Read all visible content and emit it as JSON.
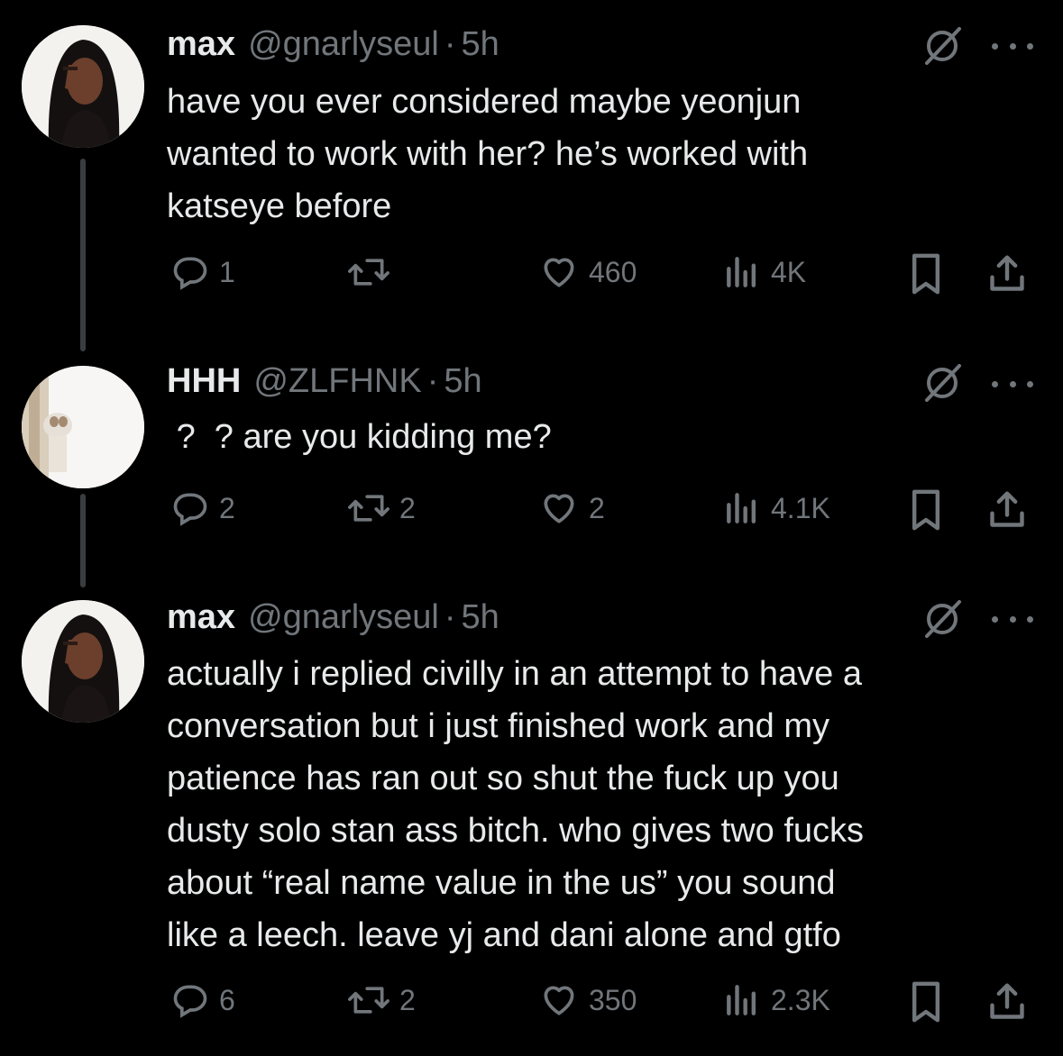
{
  "tweets": [
    {
      "name": "max",
      "handle": "@gnarlyseul",
      "dot": "·",
      "time": "5h",
      "text": "have you ever considered maybe yeonjun\nwanted to work with her? he’s worked with\nkatseye before",
      "replies": "1",
      "retweets": "",
      "likes": "460",
      "views": "4K"
    },
    {
      "name": "HHH",
      "handle": "@ZLFHNK",
      "dot": "·",
      "time": "5h",
      "text": " ?  ? are you kidding me?",
      "replies": "2",
      "retweets": "2",
      "likes": "2",
      "views": "4.1K"
    },
    {
      "name": "max",
      "handle": "@gnarlyseul",
      "dot": "·",
      "time": "5h",
      "text": "actually i replied civilly in an attempt to have a\nconversation but i just finished work and my\npatience has ran out so shut the fuck up you\ndusty solo stan ass bitch. who gives two fucks\nabout “real name value in the us” you sound\nlike a leech. leave yj and dani alone and gtfo",
      "replies": "6",
      "retweets": "2",
      "likes": "350",
      "views": "2.3K"
    }
  ],
  "icons": {
    "reply": "reply-icon",
    "retweet": "retweet-icon",
    "like": "heart-icon",
    "views": "views-icon",
    "bookmark": "bookmark-icon",
    "share": "share-icon",
    "grok": "grok-icon",
    "more": "more-icon"
  },
  "colors": {
    "background": "#000000",
    "text": "#e7e9ea",
    "muted": "#71767b",
    "line": "#3a3d40"
  }
}
